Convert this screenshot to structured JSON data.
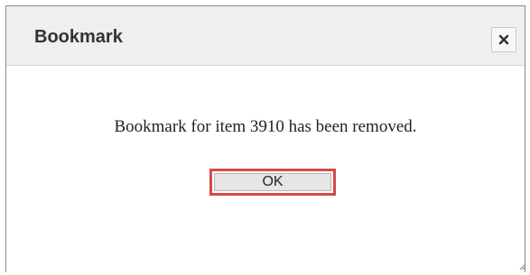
{
  "dialog": {
    "title": "Bookmark",
    "close_icon": "close-icon",
    "message": "Bookmark for item 3910 has been removed.",
    "ok_label": "OK"
  },
  "colors": {
    "titlebar_bg": "#efefef",
    "ok_highlight": "#d44a4a",
    "button_bg": "#e6e6e6"
  }
}
